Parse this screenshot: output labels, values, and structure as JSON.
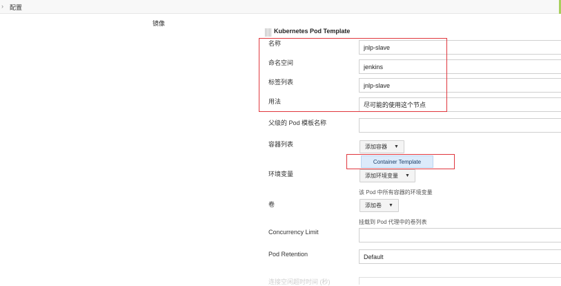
{
  "breadcrumb": {
    "label": "配置"
  },
  "section_label": "镜像",
  "template": {
    "heading": "Kubernetes Pod Template",
    "fields": {
      "name": {
        "label": "名称",
        "value": "jnlp-slave"
      },
      "namespace": {
        "label": "命名空间",
        "value": "jenkins"
      },
      "labels": {
        "label": "标签列表",
        "value": "jnlp-slave"
      },
      "usage": {
        "label": "用法",
        "value": "尽可能的使用这个节点"
      },
      "parent": {
        "label": "父级的 Pod 模板名称",
        "value": ""
      }
    },
    "containers": {
      "label": "容器列表",
      "button": "添加容器",
      "menu_item": "Container Template"
    },
    "env": {
      "label": "环境变量",
      "button": "添加环境变量",
      "hint": "该 Pod 中所有容器的环境变量"
    },
    "volumes": {
      "label": "卷",
      "button": "添加卷",
      "hint": "挂载到 Pod 代理中的卷列表"
    },
    "concurrency": {
      "label": "Concurrency Limit",
      "value": ""
    },
    "retention": {
      "label": "Pod Retention",
      "value": "Default"
    },
    "faded_label": "连接空闲超时时间 (秒)"
  },
  "colors": {
    "highlight_box": "#e0353c",
    "accent_edge": "#a8cf5c",
    "menu_bg": "#dcebfb"
  },
  "icons": {
    "breadcrumb": "chevron-right-icon",
    "dropdown": "caret-down-icon",
    "drag": "drag-handle-icon"
  }
}
